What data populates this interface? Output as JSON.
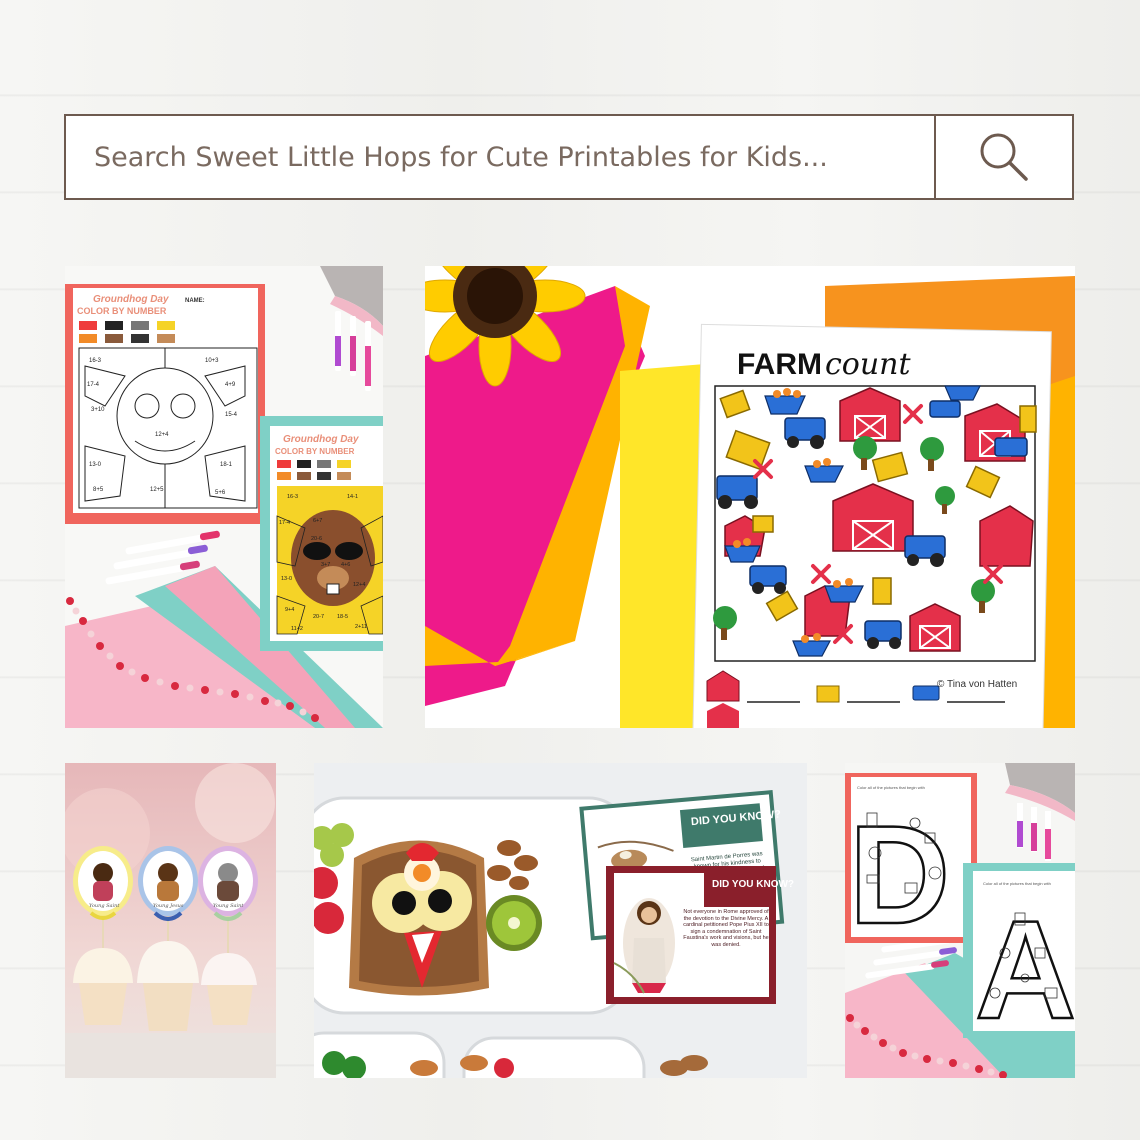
{
  "search": {
    "placeholder": "Search Sweet Little Hops for Cute Printables for Kids...",
    "icon": "search-icon"
  },
  "tiles": {
    "groundhog": {
      "title": "Groundhog Day",
      "subtitle": "COLOR BY NUMBER",
      "name_label": "NAME:",
      "instructions": "Addition and Subtraction Equations within 20",
      "crayon_labels": [
        "5",
        "9",
        "16",
        "1",
        "20",
        "14",
        "10",
        "8"
      ],
      "equations": [
        "16-3",
        "14-1",
        "17-4",
        "6+7",
        "20-6",
        "3+7",
        "4+6",
        "19-5",
        "12+4",
        "14+3",
        "15-4",
        "18-1",
        "13-0",
        "8+5",
        "9+4",
        "20-7",
        "18-5",
        "12+5",
        "11+2",
        "2+11",
        "10+3",
        "4+9",
        "3+10",
        "5+6"
      ]
    },
    "farm": {
      "title_bold": "FARM",
      "title_script": "count",
      "credit": "© Tina von Hatten"
    },
    "saints": {
      "topper_labels": [
        "Young Saint",
        "Young Jesus",
        "Young Saint"
      ]
    },
    "lunch": {
      "card1_heading": "DID YOU KNOW?",
      "card1_text": "Saint Martin de Porres was known for his kindness to animals. He even had a pet mouse",
      "card2_heading": "DID YOU KNOW?",
      "card2_text": "Not everyone in Rome approved of the devotion to the Divine Mercy. A cardinal petitioned Pope Pius XII to sign a condemnation of Saint Faustina's work and visions, but he was denied."
    },
    "alphabet": {
      "letter1": "D",
      "letter2": "A",
      "instructions": "Color all of the pictures that begin with"
    }
  },
  "colors": {
    "border_brown": "#6d5a4f",
    "coral": "#f0655d",
    "teal": "#7fd0c6",
    "pink": "#f7b6c8",
    "magenta": "#ee1a8a",
    "yellow": "#ffe629",
    "orange": "#f7931e",
    "barn_red": "#e4304a",
    "tractor_blue": "#2a6fd6",
    "card_green": "#3f7a6b",
    "card_maroon": "#8a1f2b"
  }
}
